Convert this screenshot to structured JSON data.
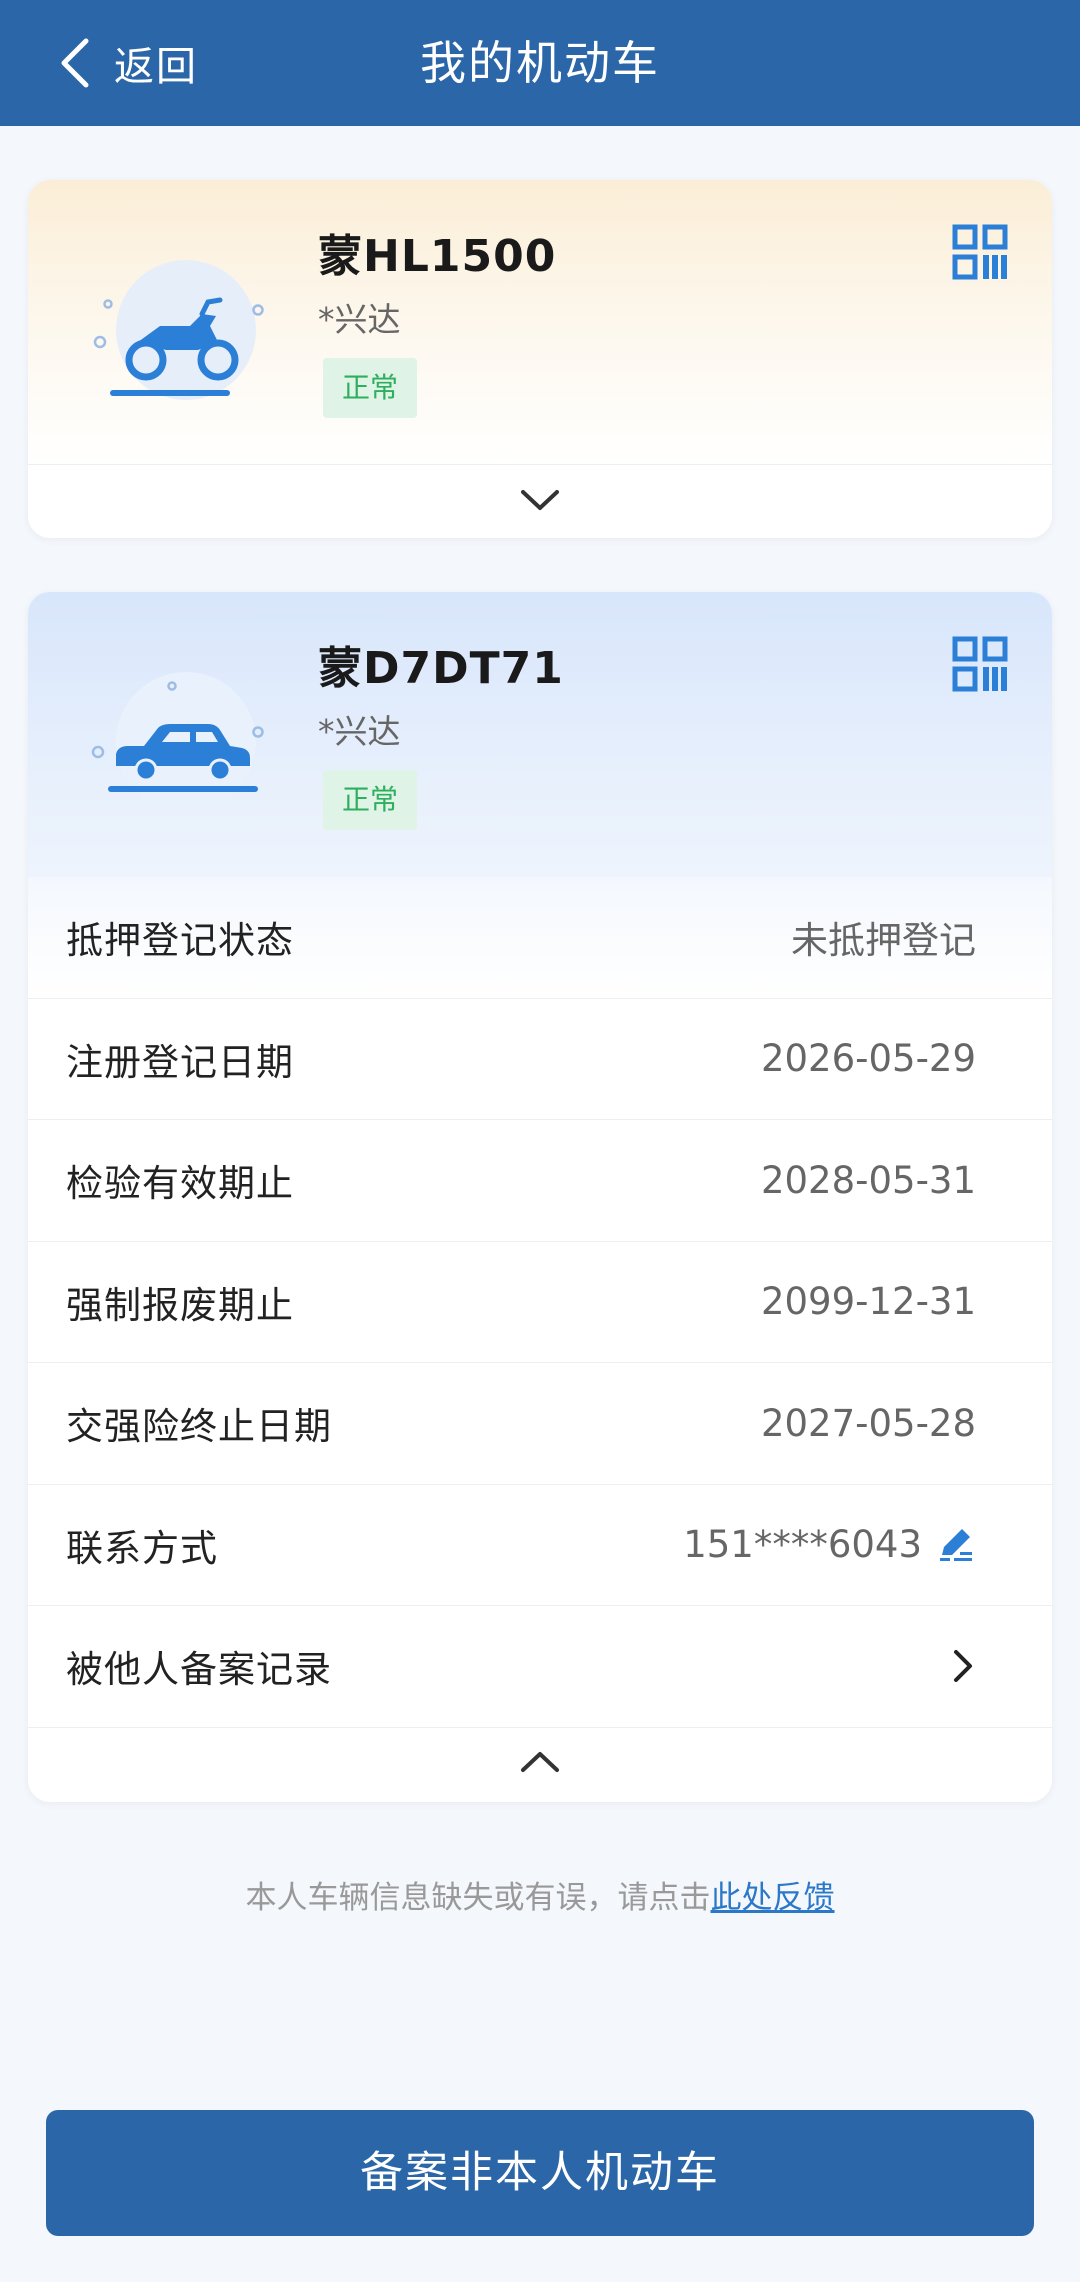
{
  "header": {
    "back_label": "返回",
    "title": "我的机动车"
  },
  "vehicles": [
    {
      "plate": "蒙HL1500",
      "owner": "*兴达",
      "status": "正常",
      "type_icon": "motorcycle-icon",
      "expanded": false
    },
    {
      "plate": "蒙D7DT71",
      "owner": "*兴达",
      "status": "正常",
      "type_icon": "car-icon",
      "expanded": true,
      "details": [
        {
          "label": "抵押登记状态",
          "value": "未抵押登记"
        },
        {
          "label": "注册登记日期",
          "value": "2026-05-29"
        },
        {
          "label": "检验有效期止",
          "value": "2028-05-31"
        },
        {
          "label": "强制报废期止",
          "value": "2099-12-31"
        },
        {
          "label": "交强险终止日期",
          "value": "2027-05-28"
        },
        {
          "label": "联系方式",
          "value": "151****6043"
        },
        {
          "label": "被他人备案记录",
          "value": ""
        }
      ]
    }
  ],
  "feedback": {
    "text": "本人车辆信息缺失或有误，请点击",
    "link": "此处反馈"
  },
  "primary_button": "备案非本人机动车",
  "colors": {
    "brand": "#2b66a8",
    "icon_blue": "#2b7fd6",
    "status_green": "#2fae5e",
    "status_bg": "#dff3e6"
  }
}
